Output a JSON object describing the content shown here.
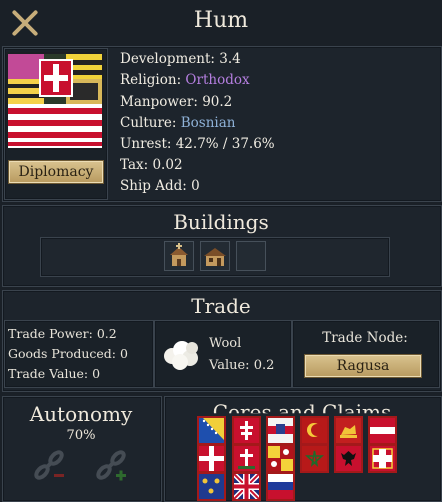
{
  "province": {
    "name": "Hum",
    "development_label": "Development:",
    "development": "3.4",
    "religion_label": "Religion:",
    "religion": "Orthodox",
    "manpower_label": "Manpower:",
    "manpower": "90.2",
    "culture_label": "Culture:",
    "culture": "Bosnian",
    "unrest_label": "Unrest:",
    "unrest": "42.7% / 37.6%",
    "tax_label": "Tax:",
    "tax": "0.02",
    "ship_label": "Ship Add:",
    "ship": "0"
  },
  "buttons": {
    "diplomacy": "Diplomacy",
    "trade_node": "Ragusa"
  },
  "buildings": {
    "title": "Buildings",
    "slots": [
      "church-icon",
      "workshop-icon",
      "empty"
    ]
  },
  "trade": {
    "title": "Trade",
    "power_label": "Trade Power:",
    "power": "0.2",
    "goods_label": "Goods Produced:",
    "goods": "0",
    "value_label": "Trade Value:",
    "value": "0",
    "good_name": "Wool",
    "good_value_label": "Value:",
    "good_value": "0.2",
    "node_label": "Trade Node:"
  },
  "autonomy": {
    "title": "Autonomy",
    "value": "70%"
  },
  "cores": {
    "title": "Cores and Claims"
  },
  "colors": {
    "accent_gold": "#c7ad7a",
    "religion": "#b57fe0",
    "culture": "#8fb2d8",
    "flag_border": "#a3191a"
  }
}
